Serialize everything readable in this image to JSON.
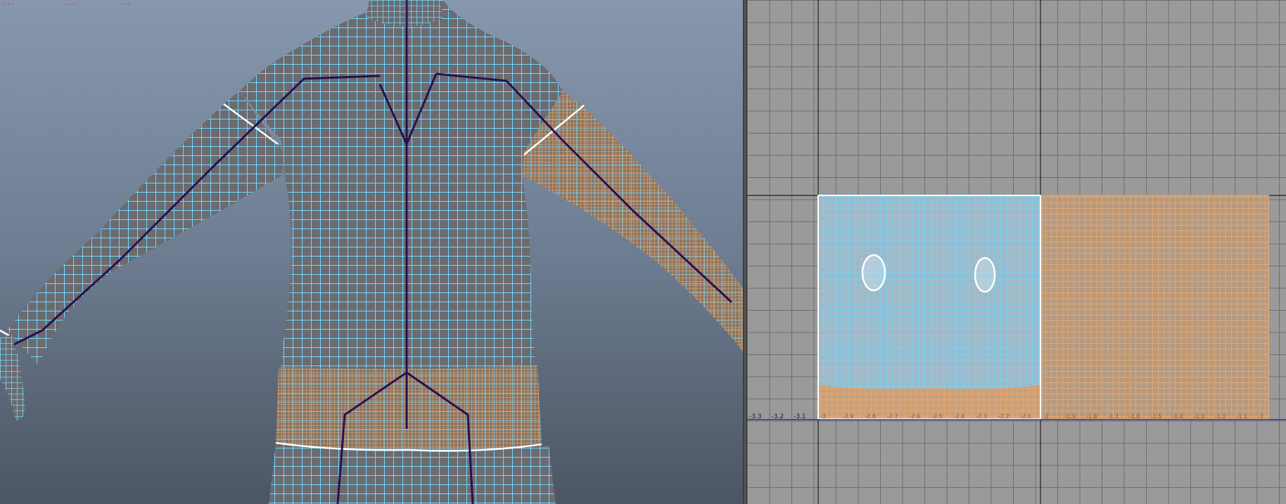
{
  "viewport": {
    "hud_values": [
      "...",
      "...",
      "..."
    ]
  },
  "uv_editor": {
    "axis_labels_left": [
      "-3.3",
      "-3.2",
      "-3.1"
    ],
    "axis_labels_tile_a": [
      "-3",
      "-2.9",
      "-2.8",
      "-2.7",
      "-2.6",
      "-2.5",
      "-2.4",
      "-2.3",
      "-2.2",
      "-2.1"
    ],
    "axis_labels_tile_b": [
      "-2",
      "-1.9",
      "-1.8",
      "-1.7",
      "-1.6",
      "-1.5",
      "-1.4",
      "-1.3",
      "-1.2",
      "-1.1",
      "-1"
    ]
  },
  "colors": {
    "wire_cyan": "#6fd8ff",
    "joint_purple": "#2a1050",
    "uv_orange": "#e8a86a",
    "grid_line": "#6e6e6e",
    "axis_blue": "#3030b0"
  }
}
